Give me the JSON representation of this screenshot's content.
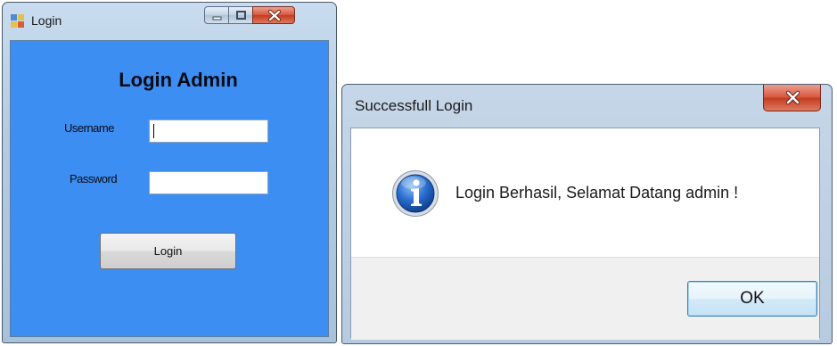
{
  "login_window": {
    "title": "Login",
    "heading": "Login Admin",
    "username_label": "Username",
    "username_value": "",
    "password_label": "Password",
    "password_value": "",
    "login_button": "Login"
  },
  "message_box": {
    "title": "Successfull Login",
    "message": "Login Berhasil, Selamat Datang admin !",
    "ok_button": "OK",
    "icon": "info-icon"
  },
  "colors": {
    "form_background": "#3d8ef2",
    "titlebar": "#b4cbe2",
    "close_button": "#c94a30"
  }
}
